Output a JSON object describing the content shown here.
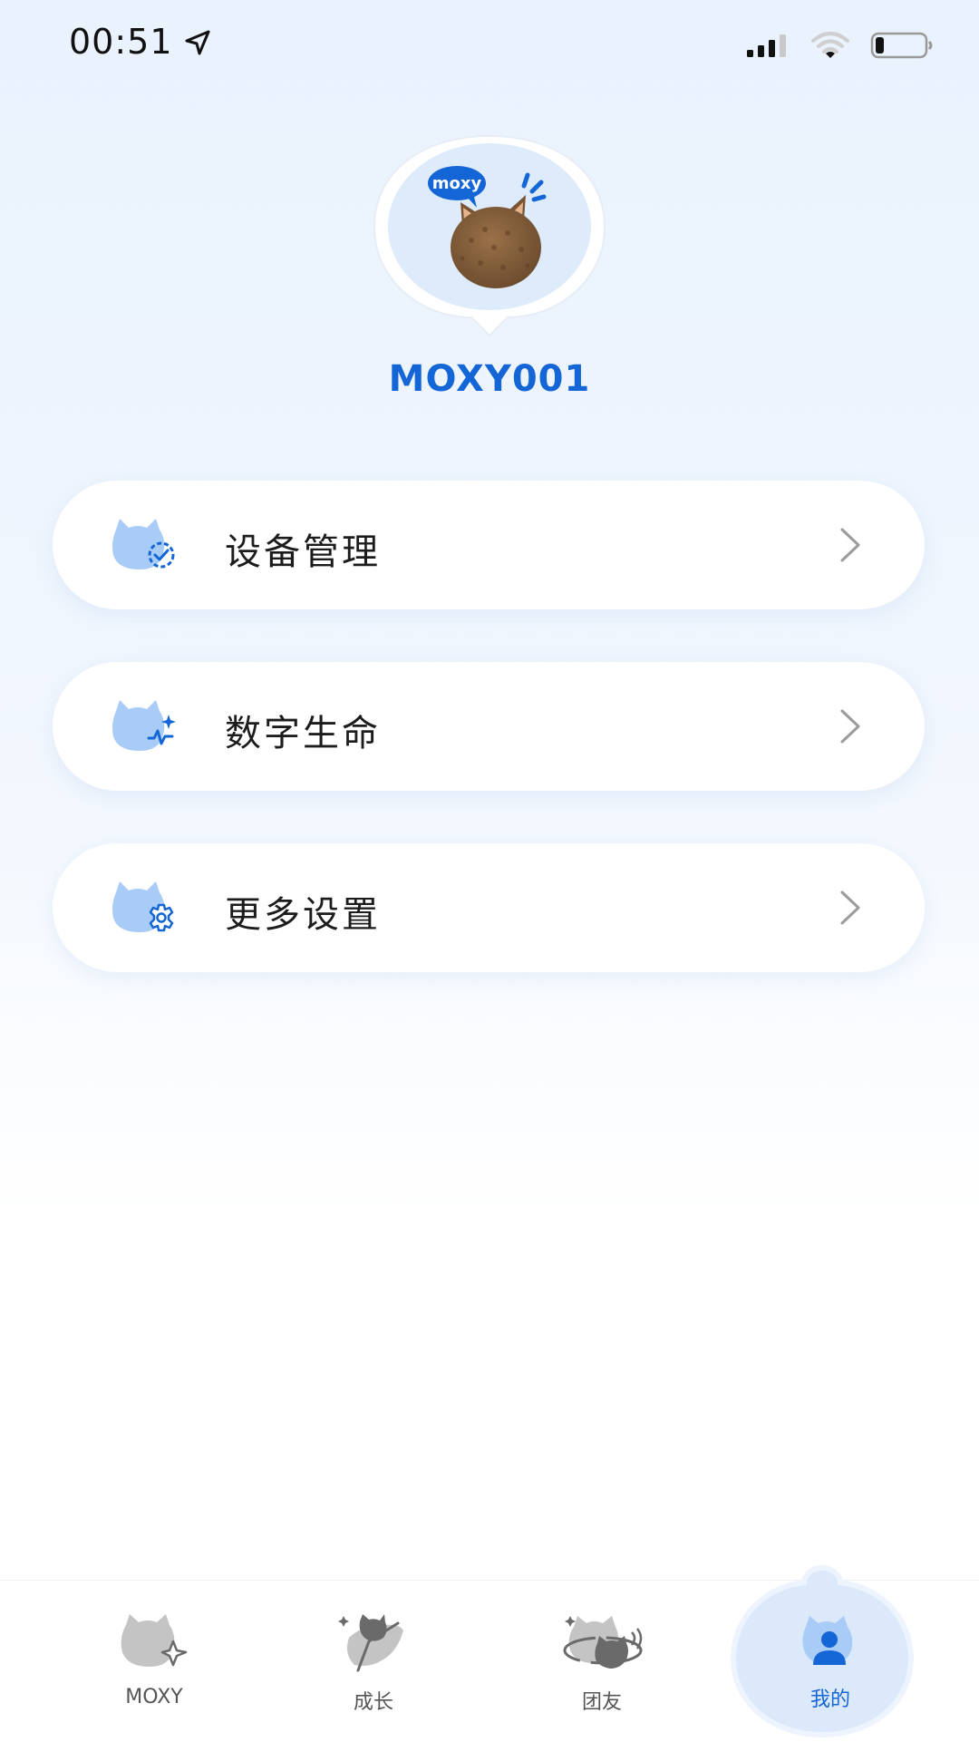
{
  "status_bar": {
    "time": "00:51",
    "icons": [
      "location-arrow-icon",
      "signal-icon",
      "wifi-icon",
      "battery-icon"
    ]
  },
  "profile": {
    "avatar_badge": "moxy",
    "username": "MOXY001"
  },
  "menu": {
    "items": [
      {
        "label": "设备管理",
        "icon": "device-manage-icon"
      },
      {
        "label": "数字生命",
        "icon": "digital-life-icon"
      },
      {
        "label": "更多设置",
        "icon": "settings-gear-icon"
      }
    ]
  },
  "tab_bar": {
    "items": [
      {
        "label": "MOXY",
        "icon": "moxy-tab-icon",
        "active": false
      },
      {
        "label": "成长",
        "icon": "growth-tab-icon",
        "active": false
      },
      {
        "label": "团友",
        "icon": "friends-tab-icon",
        "active": false
      },
      {
        "label": "我的",
        "icon": "profile-tab-icon",
        "active": true
      }
    ]
  },
  "colors": {
    "accent": "#1466d6",
    "card_bg": "#ffffff",
    "icon_light_blue": "#a9ccf7",
    "tab_inactive": "#9a9a9a"
  }
}
